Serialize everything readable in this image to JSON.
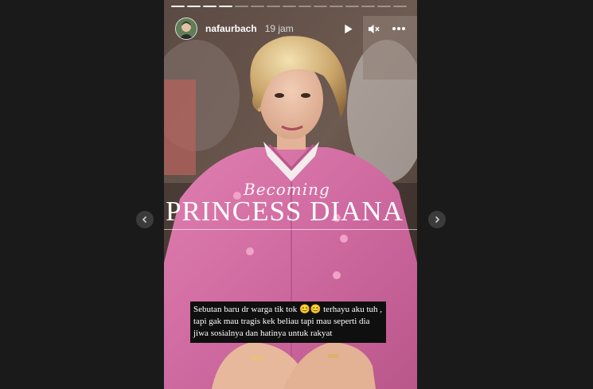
{
  "story": {
    "username": "nafaurbach",
    "time_ago": "19 jam",
    "progress": {
      "total": 15,
      "current": 4
    },
    "icons": {
      "play": "play-icon",
      "mute": "mute-icon",
      "more": "more-icon",
      "prev": "chevron-left-icon",
      "next": "chevron-right-icon"
    }
  },
  "overlay": {
    "script_title": "Becoming",
    "main_title": "PRINCESS DIANA"
  },
  "caption": {
    "text": "Sebutan baru dr warga tik tok 😊😊 terhayu aku tuh , tapi gak mau tragis kek beliau tapi mau seperti dia jiwa sosialnya dan hatinya untuk rakyat"
  },
  "colors": {
    "background": "#1b1b1b",
    "dress_pink": "#d2679d",
    "caption_bg": "#0f0f0f"
  }
}
